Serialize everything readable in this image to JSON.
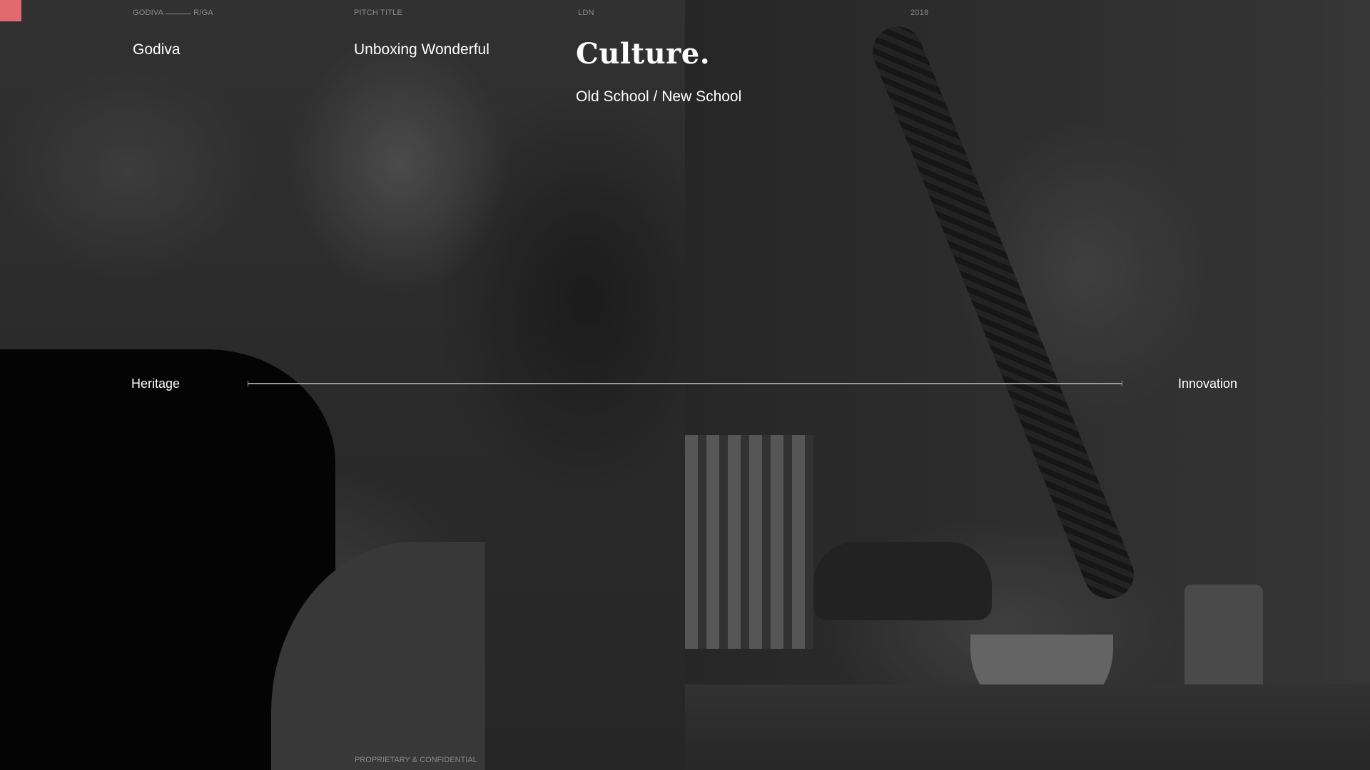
{
  "meta": {
    "client_left": "GODIVA",
    "client_right": "R/GA",
    "pitch_label": "PITCH TITLE",
    "city": "LDN",
    "year": "2018"
  },
  "header": {
    "client": "Godiva",
    "pitch_title": "Unboxing Wonderful",
    "title": "Culture.",
    "subtitle": "Old School / New School"
  },
  "scale": {
    "left_label": "Heritage",
    "right_label": "Innovation"
  },
  "footer": {
    "text": "PROPRIETARY & CONFIDENTIAL"
  },
  "colors": {
    "accent": "#e06a6e"
  }
}
